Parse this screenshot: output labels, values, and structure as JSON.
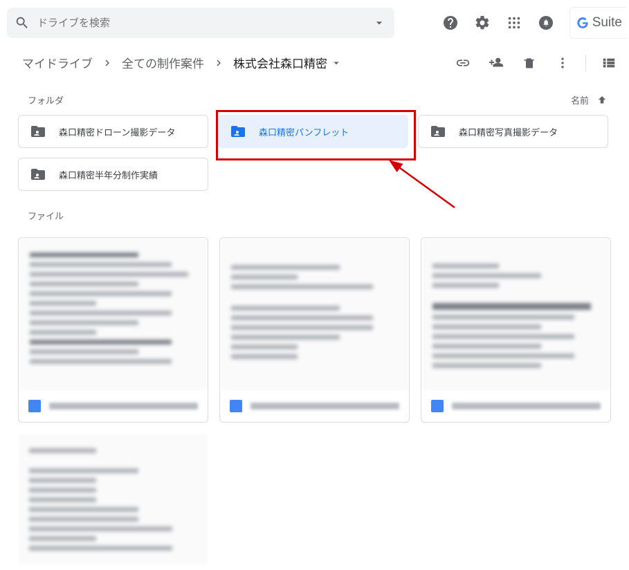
{
  "search": {
    "placeholder": "ドライブを検索"
  },
  "gsuite": {
    "label": "Suite"
  },
  "breadcrumbs": {
    "root": "マイドライブ",
    "mid": "全ての制作案件",
    "current": "株式会社森口精密"
  },
  "sections": {
    "folders": "フォルダ",
    "files": "ファイル"
  },
  "sort": {
    "label": "名前"
  },
  "folders": [
    {
      "name": "森口精密ドローン撮影データ",
      "selected": false
    },
    {
      "name": "森口精密パンフレット",
      "selected": true
    },
    {
      "name": "森口精密写真撮影データ",
      "selected": false
    },
    {
      "name": "森口精密半年分制作実績",
      "selected": false
    }
  ]
}
